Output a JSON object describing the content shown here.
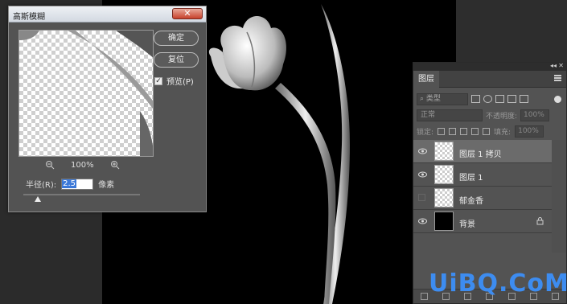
{
  "dialog": {
    "title": "高斯模糊",
    "close_glyph": "✕",
    "ok_label": "确定",
    "reset_label": "复位",
    "preview_label": "预览(P)",
    "preview_checked": true,
    "zoom_level": "100%",
    "radius_label": "半径(R):",
    "radius_value": "2.5",
    "radius_unit": "像素"
  },
  "layers_panel": {
    "tab_label": "图层",
    "filter_placeholder": "类型",
    "blend_mode": "正常",
    "opacity_label": "不透明度:",
    "opacity_value": "100%",
    "lock_label": "锁定:",
    "fill_label": "填充:",
    "fill_value": "100%",
    "layers": [
      {
        "name": "图层 1 拷贝",
        "visible": true,
        "active": true
      },
      {
        "name": "图层 1",
        "visible": true,
        "active": false
      },
      {
        "name": "郁金香",
        "visible": false,
        "active": false
      },
      {
        "name": "背景",
        "visible": true,
        "active": false,
        "locked": true
      }
    ]
  },
  "watermark": "UiBQ.CoM",
  "colors": {
    "accent": "#3b78d8",
    "watermark": "#3d8cf0",
    "panel": "#535353"
  }
}
